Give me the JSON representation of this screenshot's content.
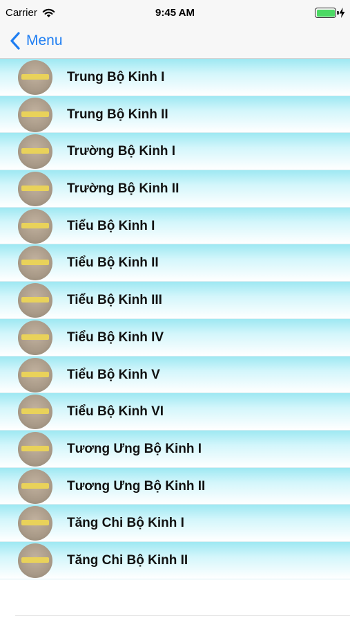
{
  "status_bar": {
    "carrier": "Carrier",
    "time": "9:45 AM",
    "battery_color": "#4cd964"
  },
  "nav": {
    "back_label": "Menu",
    "accent_color": "#1f7ef2",
    "back_icon": "chevron-left-icon"
  },
  "list": {
    "items": [
      {
        "label": "Trung Bộ Kinh I"
      },
      {
        "label": "Trung Bộ Kinh II"
      },
      {
        "label": "Trường Bộ Kinh I"
      },
      {
        "label": "Trường Bộ Kinh II"
      },
      {
        "label": "Tiểu Bộ Kinh I"
      },
      {
        "label": "Tiểu Bộ Kinh II"
      },
      {
        "label": "Tiểu Bộ Kinh III"
      },
      {
        "label": "Tiểu Bộ Kinh IV"
      },
      {
        "label": "Tiểu Bộ Kinh V"
      },
      {
        "label": "Tiểu Bộ Kinh VI"
      },
      {
        "label": "Tương Ưng Bộ Kinh I"
      },
      {
        "label": "Tương Ưng Bộ Kinh II"
      },
      {
        "label": "Tăng Chi Bộ Kinh I"
      },
      {
        "label": "Tăng Chi Bộ Kinh II"
      }
    ]
  }
}
